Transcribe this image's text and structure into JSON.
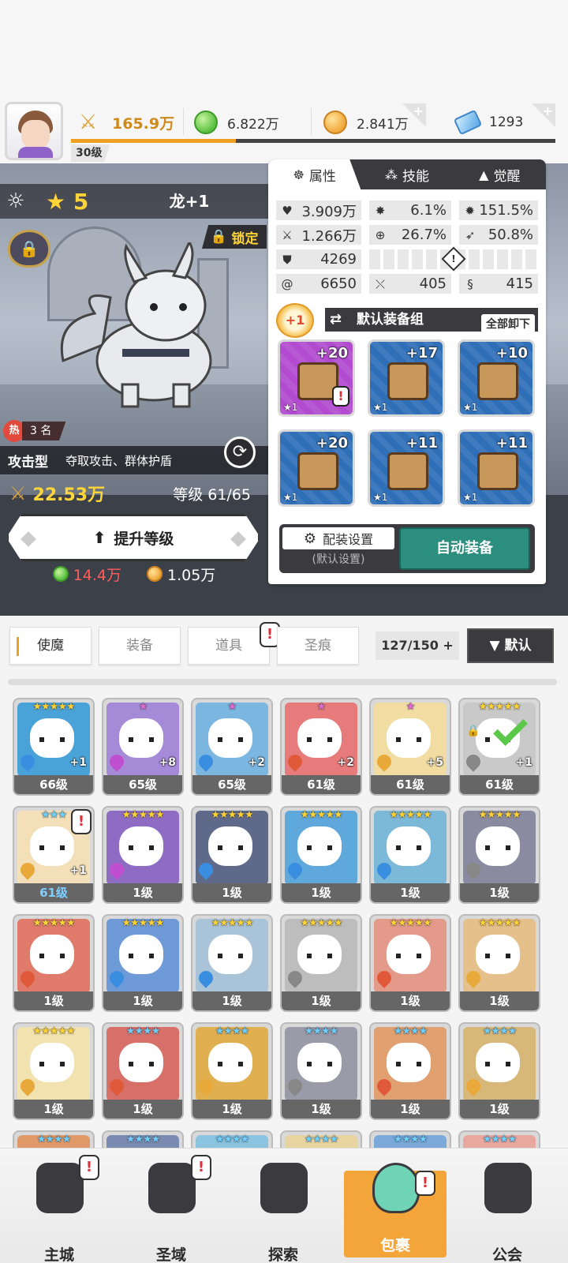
{
  "resources": {
    "power": "165.9万",
    "green_gem": "6.822万",
    "gold": "2.841万",
    "crystal": "1293"
  },
  "player": {
    "level_label": "30级",
    "xp_fraction": 0.34
  },
  "hero": {
    "stars": "5",
    "name": "龙+1",
    "lock_label": "锁定",
    "hot_badge": "热",
    "hot_rank": "3 名",
    "type": "攻击型",
    "skills_desc": "夺取攻击、群体护盾",
    "power": "22.53万",
    "level_text": "等级 61/65",
    "upgrade_label": "提升等级",
    "cost_green": "14.4万",
    "cost_gold": "1.05万"
  },
  "panel": {
    "tabs": [
      {
        "label": "属性",
        "icon": "attribute-icon"
      },
      {
        "label": "技能",
        "icon": "skill-icon"
      },
      {
        "label": "觉醒",
        "icon": "awaken-icon"
      }
    ],
    "stats": {
      "hp": "3.909万",
      "crit": "6.1%",
      "crit_dmg": "151.5%",
      "atk": "1.266万",
      "accuracy": "26.7%",
      "speed": "50.8%",
      "def": "4269",
      "stat_a": "6650",
      "stat_b": "405",
      "stat_c": "415"
    },
    "plus_badge": "+1",
    "equip_group": "默认装备组",
    "unequip_all": "全部卸下",
    "equips": [
      {
        "plus": "+20",
        "star": "★1",
        "rarity": "purple",
        "alert": "!"
      },
      {
        "plus": "+17",
        "star": "★1",
        "rarity": "blue"
      },
      {
        "plus": "+10",
        "star": "★1",
        "rarity": "blue"
      },
      {
        "plus": "+20",
        "star": "★1",
        "rarity": "blue"
      },
      {
        "plus": "+11",
        "star": "★1",
        "rarity": "blue"
      },
      {
        "plus": "+11",
        "star": "★1",
        "rarity": "blue"
      }
    ],
    "config_label": "配装设置",
    "config_sub": "(默认设置)",
    "auto_equip": "自动装备"
  },
  "filters": {
    "tabs": [
      "使魔",
      "装备",
      "道具",
      "圣痕"
    ],
    "count": "127/150",
    "count_plus": "+",
    "sort": "▼ 默认",
    "alert": "!"
  },
  "heroes": [
    {
      "level": "66级",
      "stars": "★★★★★",
      "star_color": "gold",
      "plus": "+1",
      "bg": "#4aa3d8",
      "elem": "#3a8ee0"
    },
    {
      "level": "65级",
      "stars": "★",
      "star_color": "pink",
      "plus": "+8",
      "bg": "#a58ad8",
      "elem": "#c04fd0"
    },
    {
      "level": "65级",
      "stars": "★",
      "star_color": "pink",
      "plus": "+2",
      "bg": "#7ab6e0",
      "elem": "#3a8ee0"
    },
    {
      "level": "61级",
      "stars": "★",
      "star_color": "pink",
      "plus": "+2",
      "bg": "#e77a7a",
      "elem": "#e05a3a"
    },
    {
      "level": "61级",
      "stars": "★",
      "star_color": "pink",
      "plus": "+5",
      "bg": "#f1dca2",
      "elem": "#e8a83a"
    },
    {
      "level": "61级",
      "stars": "★★★★★",
      "star_color": "gold",
      "plus": "+1",
      "bg": "#c9c9c9",
      "elem": "#888888",
      "locked": true,
      "checked": true
    },
    {
      "level": "61级",
      "stars": "★★★",
      "star_color": "blue",
      "plus": "+1",
      "bg": "#f3e0b8",
      "elem": "#e8a83a",
      "alert": "!",
      "level_blue": true
    },
    {
      "level": "1级",
      "stars": "★★★★★",
      "star_color": "gold",
      "bg": "#8e6cc4",
      "elem": "#c04fd0"
    },
    {
      "level": "1级",
      "stars": "★★★★★",
      "star_color": "gold",
      "bg": "#5f6a8a",
      "elem": "#3a8ee0"
    },
    {
      "level": "1级",
      "stars": "★★★★★",
      "star_color": "gold",
      "bg": "#5ea8dc",
      "elem": "#3a8ee0"
    },
    {
      "level": "1级",
      "stars": "★★★★★",
      "star_color": "gold",
      "bg": "#7cb8d8",
      "elem": "#3a8ee0"
    },
    {
      "level": "1级",
      "stars": "★★★★★",
      "star_color": "gold",
      "bg": "#8a8aa0",
      "elem": "#888888"
    },
    {
      "level": "1级",
      "stars": "★★★★★",
      "star_color": "gold",
      "bg": "#e07a6a",
      "elem": "#e05a3a"
    },
    {
      "level": "1级",
      "stars": "★★★★★",
      "star_color": "gold",
      "bg": "#6f9ad8",
      "elem": "#3a8ee0"
    },
    {
      "level": "1级",
      "stars": "★★★★★",
      "star_color": "gold",
      "bg": "#a9c4d8",
      "elem": "#3a8ee0"
    },
    {
      "level": "1级",
      "stars": "★★★★★",
      "star_color": "gold",
      "bg": "#bdbdbd",
      "elem": "#888888"
    },
    {
      "level": "1级",
      "stars": "★★★★★",
      "star_color": "gold",
      "bg": "#e49a8a",
      "elem": "#e05a3a"
    },
    {
      "level": "1级",
      "stars": "★★★★★",
      "star_color": "gold",
      "bg": "#e6c08a",
      "elem": "#e8a83a"
    },
    {
      "level": "1级",
      "stars": "★★★★★",
      "star_color": "gold",
      "bg": "#f2e2b0",
      "elem": "#e8a83a"
    },
    {
      "level": "1级",
      "stars": "★★★★",
      "star_color": "blue",
      "bg": "#d8706a",
      "elem": "#e05a3a"
    },
    {
      "level": "1级",
      "stars": "★★★★",
      "star_color": "blue",
      "bg": "#e0b050",
      "elem": "#e8a83a"
    },
    {
      "level": "1级",
      "stars": "★★★★",
      "star_color": "blue",
      "bg": "#9a9aa8",
      "elem": "#888888"
    },
    {
      "level": "1级",
      "stars": "★★★★",
      "star_color": "blue",
      "bg": "#e0a070",
      "elem": "#e05a3a"
    },
    {
      "level": "1级",
      "stars": "★★★★",
      "star_color": "blue",
      "bg": "#d8b878",
      "elem": "#e8a83a"
    },
    {
      "level": "",
      "stars": "★★★★",
      "star_color": "blue",
      "bg": "#e09a6a",
      "elem": ""
    },
    {
      "level": "",
      "stars": "★★★★",
      "star_color": "blue",
      "bg": "#7a8ab0",
      "elem": ""
    },
    {
      "level": "",
      "stars": "★★★★",
      "star_color": "blue",
      "bg": "#8ac4e0",
      "elem": ""
    },
    {
      "level": "",
      "stars": "★★★★",
      "star_color": "blue",
      "bg": "#e8d4a0",
      "elem": ""
    },
    {
      "level": "",
      "stars": "★★★★",
      "star_color": "blue",
      "bg": "#7aa8d8",
      "elem": ""
    },
    {
      "level": "",
      "stars": "★★★★",
      "star_color": "blue",
      "bg": "#e8a8a0",
      "elem": ""
    }
  ],
  "nav": [
    {
      "label": "主城",
      "icon": "castle-icon",
      "alert": "!"
    },
    {
      "label": "圣域",
      "icon": "sanctuary-icon",
      "alert": "!"
    },
    {
      "label": "探索",
      "icon": "explore-icon"
    },
    {
      "label": "包裹",
      "icon": "bag-icon",
      "alert": "!",
      "active": true
    },
    {
      "label": "公会",
      "icon": "guild-icon"
    }
  ]
}
